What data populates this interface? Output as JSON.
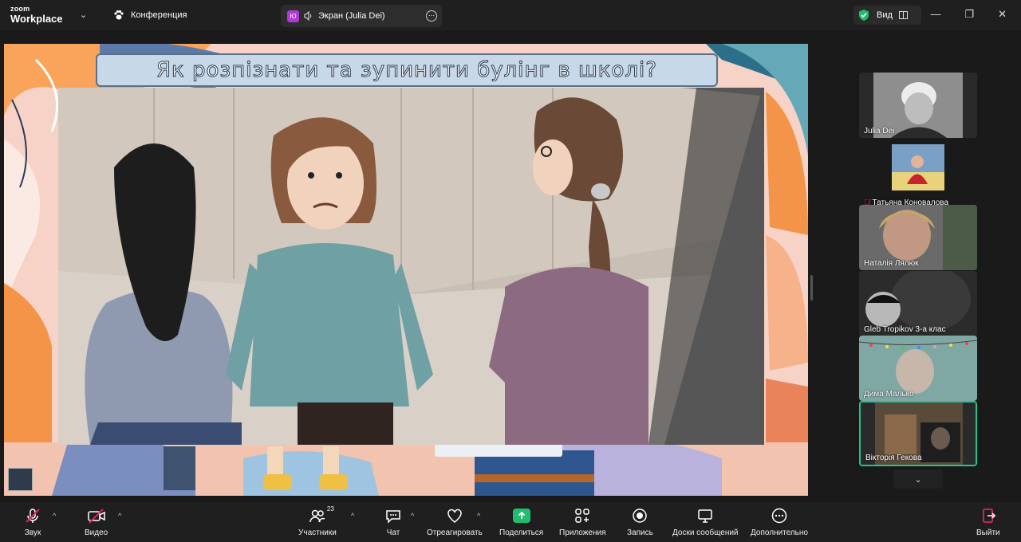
{
  "app": {
    "logo_line1": "zoom",
    "logo_line2": "Workplace"
  },
  "meeting": {
    "title": "Конференция"
  },
  "screen_tab": {
    "badge": "Ю",
    "label": "Экран (Julia Dei)"
  },
  "view": {
    "label": "Вид"
  },
  "slide": {
    "title": "Як розпізнати та зупинити булінг в школі?"
  },
  "participants": [
    {
      "name": "Julia Dei",
      "muted": false,
      "active": false
    },
    {
      "name": "Татьяна Коновалова",
      "muted": true,
      "active": false
    },
    {
      "name": "Наталія Лялюк",
      "muted": false,
      "active": false
    },
    {
      "name": "Gleb Tropikov  3-а клас",
      "muted": false,
      "active": false
    },
    {
      "name": "Дима Малько",
      "muted": false,
      "active": false
    },
    {
      "name": "Вікторія Гекова",
      "muted": false,
      "active": true
    }
  ],
  "toolbar": {
    "audio": "Звук",
    "video": "Видео",
    "participants": "Участники",
    "participants_count": "23",
    "chat": "Чат",
    "react": "Отреагировать",
    "share": "Поделиться",
    "apps": "Приложения",
    "record": "Запись",
    "whiteboards": "Доски сообщений",
    "more": "Дополнительно",
    "leave": "Выйти"
  },
  "colors": {
    "share_green": "#1fbd6e",
    "active_border": "#22c38e",
    "mute_red": "#e0245e",
    "leave_red": "#e0245e"
  }
}
